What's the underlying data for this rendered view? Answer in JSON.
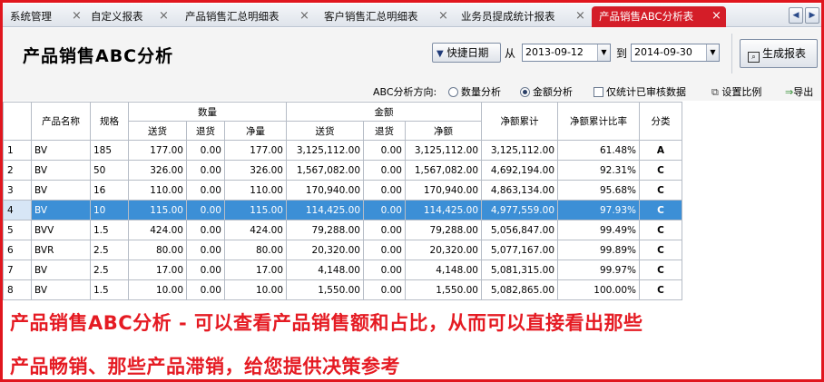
{
  "tabs": [
    {
      "label": "系统管理"
    },
    {
      "label": "自定义报表"
    },
    {
      "label": "产品销售汇总明细表"
    },
    {
      "label": "客户销售汇总明细表"
    },
    {
      "label": "业务员提成统计报表"
    },
    {
      "label": "产品销售ABC分析表",
      "active": true
    }
  ],
  "tab_close_glyph": "×",
  "nav": {
    "prev": "◀",
    "next": "▶"
  },
  "header": {
    "title": "产品销售ABC分析",
    "quick_date_label": "快捷日期",
    "from_label": "从",
    "from_date": "2013-09-12",
    "to_label": "到",
    "to_date": "2014-09-30",
    "generate_label": "生成报表"
  },
  "options": {
    "direction_label": "ABC分析方向:",
    "by_quantity": "数量分析",
    "by_amount": "金额分析",
    "selected": "by_amount",
    "audited_only": "仅统计已审核数据",
    "set_ratio": "设置比例",
    "export": "导出"
  },
  "table": {
    "headers": {
      "name": "产品名称",
      "spec": "规格",
      "qty_group": "数量",
      "amt_group": "金额",
      "ship": "送货",
      "ret": "退货",
      "net": "净量",
      "amt_ship": "送货",
      "amt_ret": "退货",
      "amt_net": "净额",
      "cum": "净额累计",
      "cum_ratio": "净额累计比率",
      "class": "分类"
    },
    "rows": [
      [
        "1",
        "BV",
        "185",
        "177.00",
        "0.00",
        "177.00",
        "3,125,112.00",
        "0.00",
        "3,125,112.00",
        "3,125,112.00",
        "61.48%",
        "A"
      ],
      [
        "2",
        "BV",
        "50",
        "326.00",
        "0.00",
        "326.00",
        "1,567,082.00",
        "0.00",
        "1,567,082.00",
        "4,692,194.00",
        "92.31%",
        "C"
      ],
      [
        "3",
        "BV",
        "16",
        "110.00",
        "0.00",
        "110.00",
        "170,940.00",
        "0.00",
        "170,940.00",
        "4,863,134.00",
        "95.68%",
        "C"
      ],
      [
        "4",
        "BV",
        "10",
        "115.00",
        "0.00",
        "115.00",
        "114,425.00",
        "0.00",
        "114,425.00",
        "4,977,559.00",
        "97.93%",
        "C"
      ],
      [
        "5",
        "BVV",
        "1.5",
        "424.00",
        "0.00",
        "424.00",
        "79,288.00",
        "0.00",
        "79,288.00",
        "5,056,847.00",
        "99.49%",
        "C"
      ],
      [
        "6",
        "BVR",
        "2.5",
        "80.00",
        "0.00",
        "80.00",
        "20,320.00",
        "0.00",
        "20,320.00",
        "5,077,167.00",
        "99.89%",
        "C"
      ],
      [
        "7",
        "BV",
        "2.5",
        "17.00",
        "0.00",
        "17.00",
        "4,148.00",
        "0.00",
        "4,148.00",
        "5,081,315.00",
        "99.97%",
        "C"
      ],
      [
        "8",
        "BV",
        "1.5",
        "10.00",
        "0.00",
        "10.00",
        "1,550.00",
        "0.00",
        "1,550.00",
        "5,082,865.00",
        "100.00%",
        "C"
      ]
    ],
    "selected_row": 3
  },
  "promo": {
    "line1": "产品销售ABC分析 - 可以查看产品销售额和占比，从而可以直接看出那些",
    "line2": "产品畅销、那些产品滞销，给您提供决策参考"
  },
  "colors": {
    "accent": "#e51b23",
    "selection": "#3c8fd6"
  }
}
